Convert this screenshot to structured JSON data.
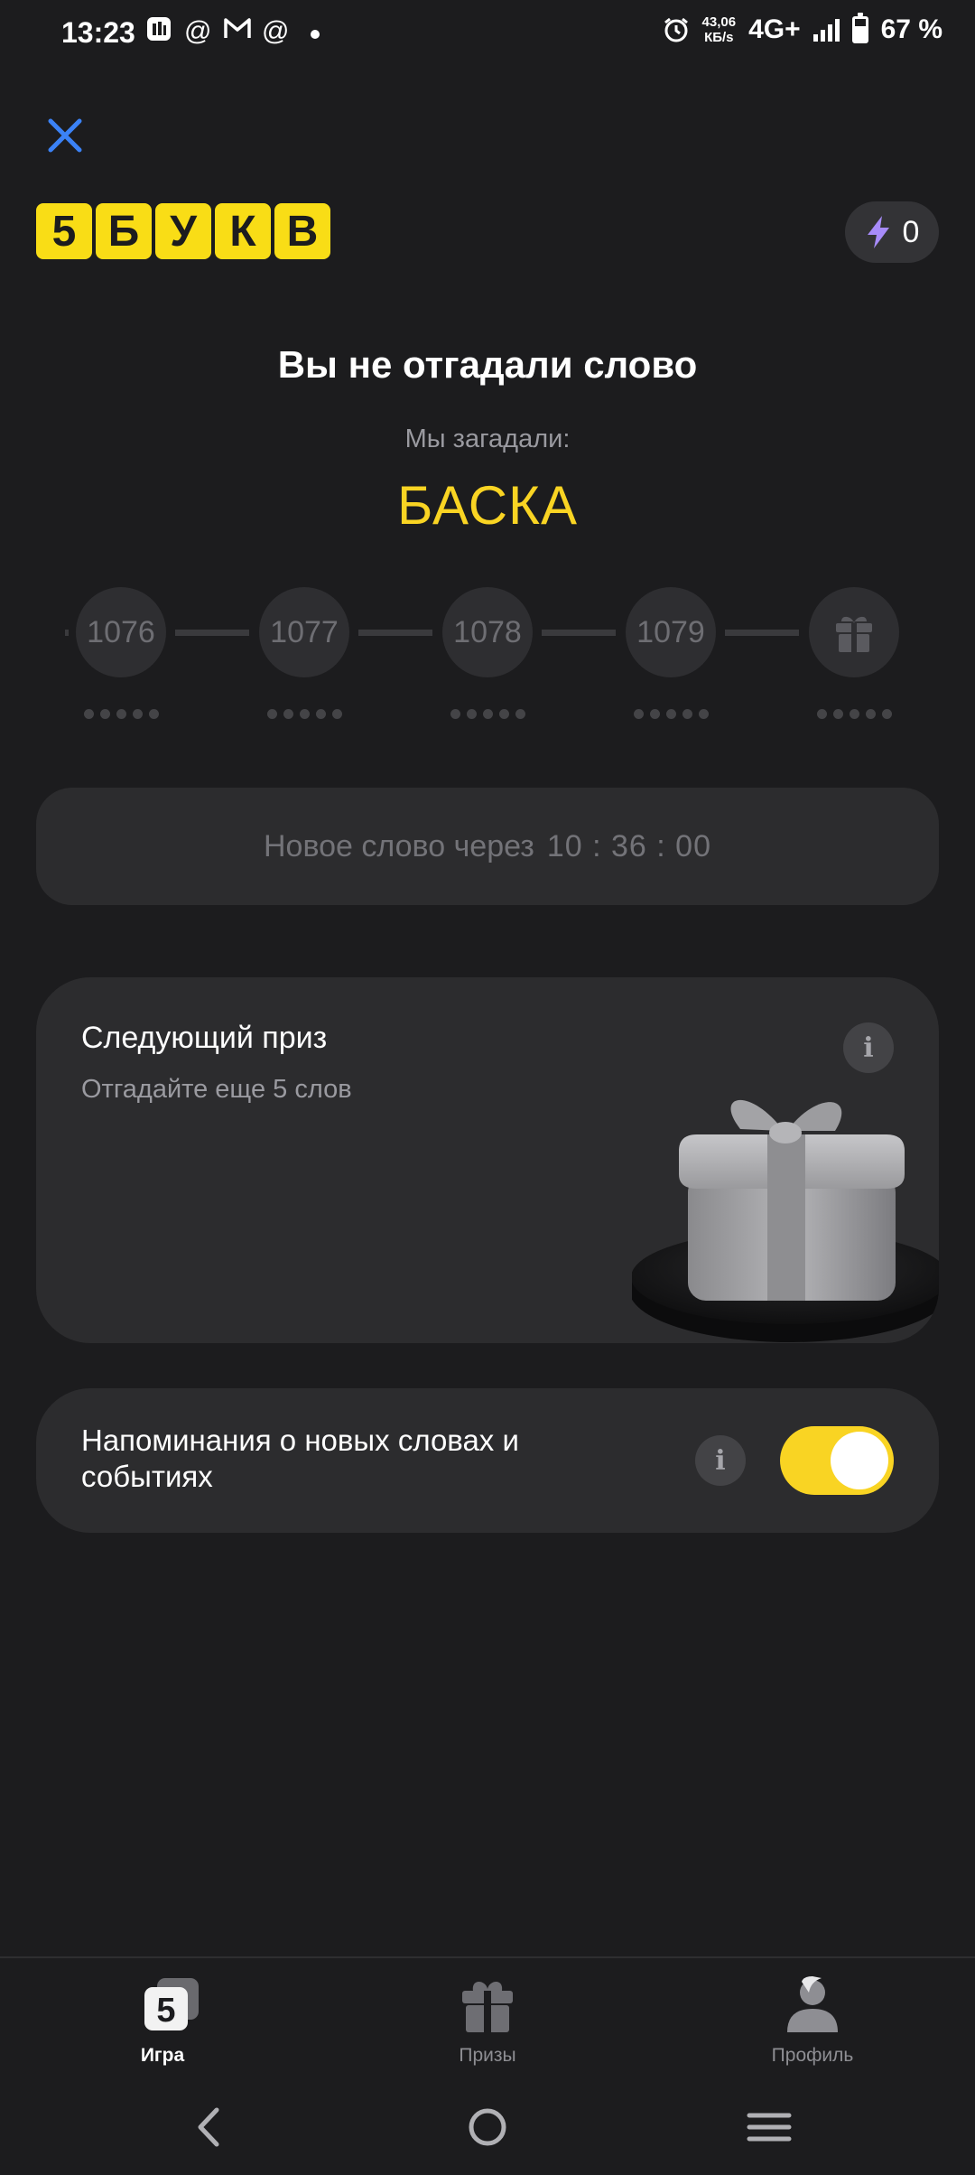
{
  "status_bar": {
    "time": "13:23",
    "speed_value": "43,06",
    "speed_unit": "КБ/s",
    "network": "4G+",
    "battery": "67 %",
    "battery_level": 0.67,
    "left_icons": [
      "app-notification-icon",
      "at-sign-icon",
      "gmail-icon",
      "at-sign-icon",
      "dot-icon"
    ],
    "right_icons": [
      "alarm-icon",
      "signal-icon",
      "battery-icon"
    ]
  },
  "header": {
    "logo_letters": [
      "5",
      "Б",
      "У",
      "К",
      "В"
    ],
    "energy_count": "0"
  },
  "result": {
    "title": "Вы не отгадали слово",
    "subtitle": "Мы загадали:",
    "word": "БАСКА"
  },
  "progress": {
    "nodes": [
      "1076",
      "1077",
      "1078",
      "1079"
    ],
    "final_icon": "gift-icon"
  },
  "countdown": {
    "label": "Новое слово через",
    "time": "10 : 36 : 00"
  },
  "prize_card": {
    "title": "Следующий приз",
    "description": "Отгадайте еще 5 слов"
  },
  "reminders": {
    "label": "Напоминания о новых словах и событиях",
    "enabled": true
  },
  "tabs": [
    {
      "label": "Игра",
      "icon": "game-icon",
      "active": true
    },
    {
      "label": "Призы",
      "icon": "gift-icon",
      "active": false
    },
    {
      "label": "Профиль",
      "icon": "profile-icon",
      "active": false
    }
  ],
  "colors": {
    "accent_yellow": "#f9d423",
    "background": "#1c1c1e",
    "card": "#2c2c2e",
    "close_blue": "#3b82f6",
    "energy_purple": "#a78bfa"
  }
}
